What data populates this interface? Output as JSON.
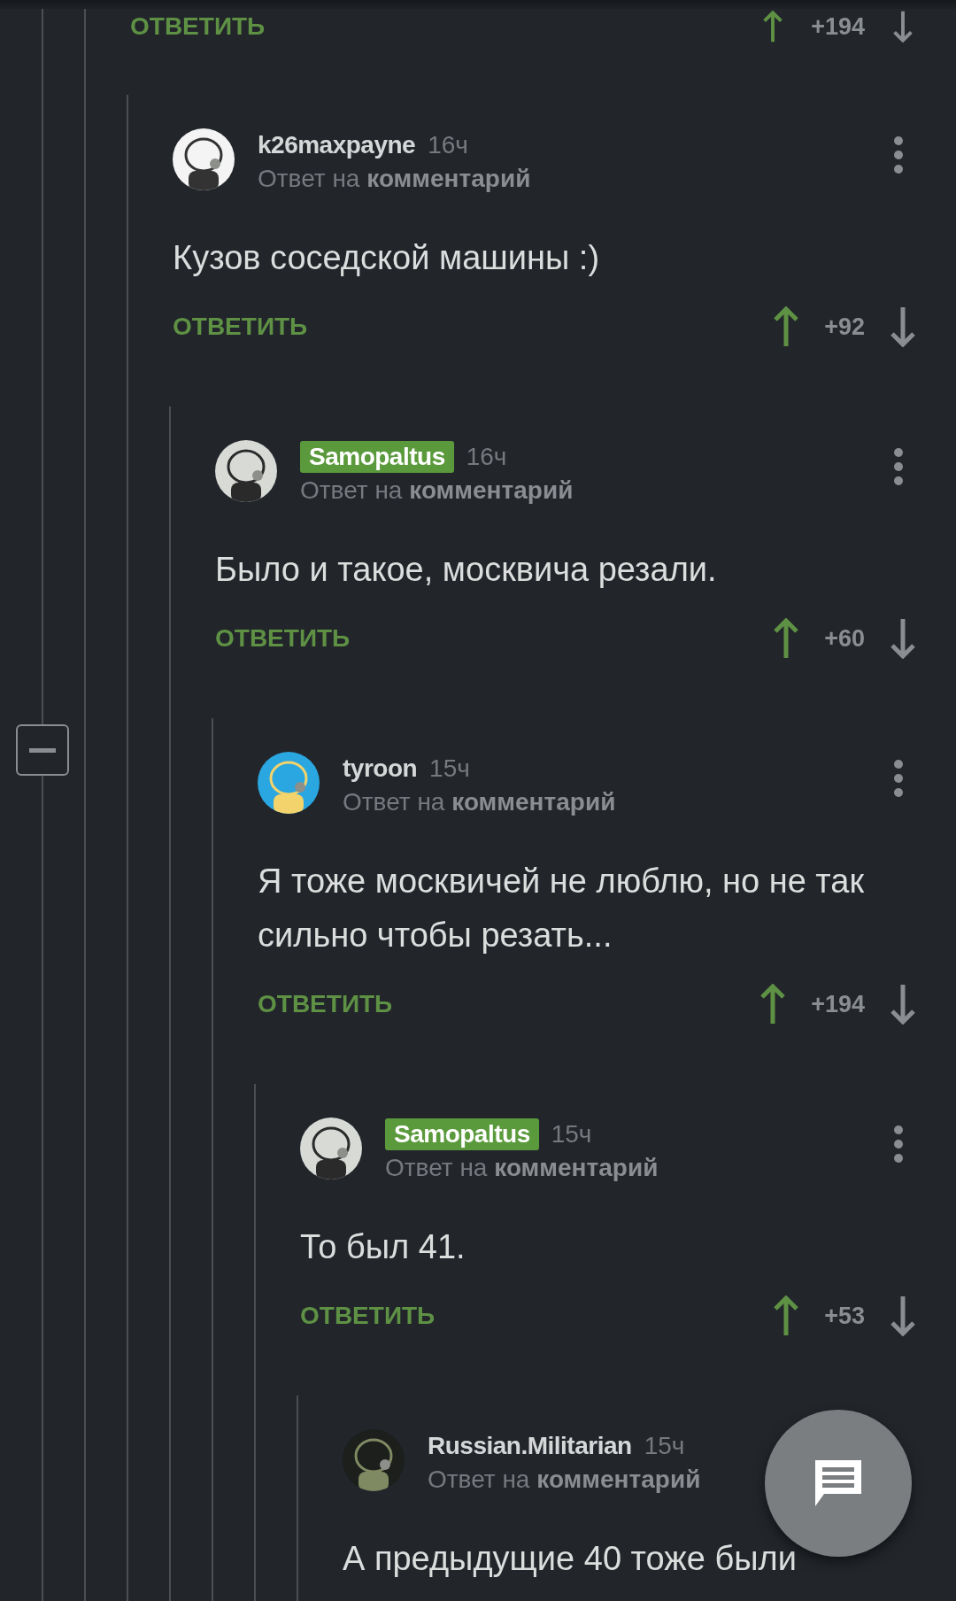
{
  "previous_comment": {
    "reply_label": "ОТВЕТИТЬ",
    "score": "+194",
    "replies": [
      {
        "author": "k26maxpayne",
        "is_author": false,
        "time": "16ч",
        "reply_to": "Ответ на **комментарий**",
        "text": "Кузов соседской машины :)",
        "reply_label": "ОТВЕТИТЬ",
        "score": "+92",
        "children": [
          {
            "author": "Samopaltus",
            "is_author": true,
            "time": "16ч",
            "reply_to": "Ответ на **комментарий**",
            "text": "Было и такое, москвича резали.",
            "reply_label": "ОТВЕТИТЬ",
            "score": "+60",
            "children": [
              {
                "author": "tyroon",
                "is_author": false,
                "time": "15ч",
                "reply_to": "Ответ на **комментарий**",
                "text": "Я тоже москвичей не люблю, но не так сильно чтобы резать...",
                "reply_label": "ОТВЕТИТЬ",
                "score": "+194",
                "children": [
                  {
                    "author": "Samopaltus",
                    "is_author": true,
                    "time": "15ч",
                    "reply_to": "Ответ на **комментарий**",
                    "text": "То был 41.",
                    "reply_label": "ОТВЕТИТЬ",
                    "score": "+53",
                    "children": [
                      {
                        "author": "Russian.Militarian",
                        "is_author": false,
                        "time": "15ч",
                        "reply_to": "Ответ на **комментарий**",
                        "text": "А предыдущие 40 тоже были"
                      }
                    ]
                  }
                ]
              }
            ]
          }
        ]
      }
    ]
  }
}
